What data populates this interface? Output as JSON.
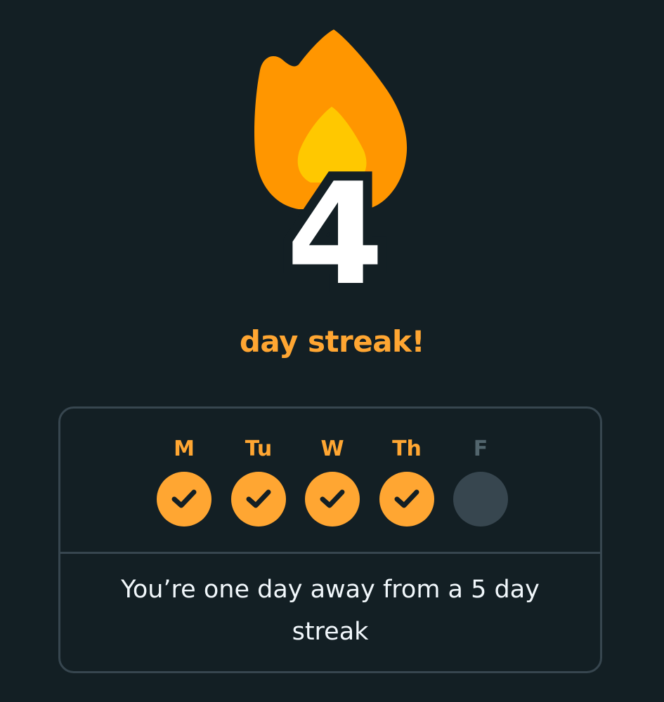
{
  "streak": {
    "count": "4",
    "title": "day streak!",
    "flame_icon": "fire-icon"
  },
  "week": {
    "days": [
      {
        "label": "M",
        "done": true
      },
      {
        "label": "Tu",
        "done": true
      },
      {
        "label": "W",
        "done": true
      },
      {
        "label": "Th",
        "done": true
      },
      {
        "label": "F",
        "done": false
      }
    ],
    "check_icon": "checkmark-icon"
  },
  "message": "You’re one day away from a 5 day streak",
  "colors": {
    "background": "#131f24",
    "accent": "#ffa632",
    "flame_outer": "#ff9600",
    "flame_inner": "#ffc800",
    "pending_day": "#37464f",
    "border": "#37464f",
    "text": "#f1f7fb"
  }
}
